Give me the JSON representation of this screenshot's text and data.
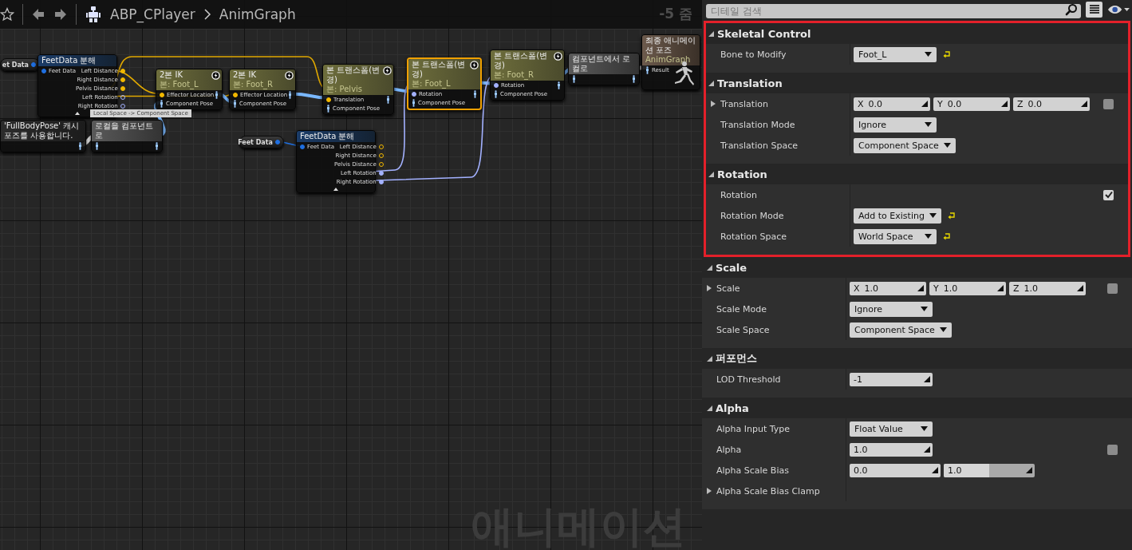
{
  "toolbar": {
    "breadcrumb": [
      "ABP_CPlayer",
      "AnimGraph"
    ],
    "zoom": "-5 줌"
  },
  "graph": {
    "watermark": "애니메이션",
    "tooltip": "Local Space -> Component Space",
    "nodes": [
      {
        "kind": "variable",
        "selected": false,
        "title": "et Data",
        "outputs": [
          {
            "kind": "struct",
            "connected": true
          }
        ]
      },
      {
        "kind": "break",
        "selected": false,
        "title": "FeetData 분해",
        "inputs": [
          {
            "kind": "struct",
            "connected": true,
            "label": "Feet Data"
          }
        ],
        "outputs": [
          {
            "kind": "float",
            "connected": true,
            "label": "Left Distance"
          },
          {
            "kind": "float",
            "connected": true,
            "label": "Right Distance"
          },
          {
            "kind": "float",
            "connected": true,
            "label": "Pelvis Distance"
          },
          {
            "kind": "rotator",
            "connected": false,
            "label": "Left Rotation"
          },
          {
            "kind": "rotator",
            "connected": false,
            "label": "Right Rotation"
          }
        ]
      },
      {
        "kind": "skeletal",
        "selected": false,
        "title": "2본 IK",
        "subtitle": "본: Foot_L",
        "inputs": [
          {
            "kind": "float",
            "connected": true,
            "label": "Effector Location"
          },
          {
            "kind": "pose",
            "connected": true,
            "label": "Component Pose"
          }
        ],
        "outputs": [
          {
            "kind": "pose",
            "connected": true
          }
        ]
      },
      {
        "kind": "skeletal",
        "selected": false,
        "title": "2본 IK",
        "subtitle": "본: Foot_R",
        "inputs": [
          {
            "kind": "float",
            "connected": true,
            "label": "Effector Location"
          },
          {
            "kind": "pose",
            "connected": true,
            "label": "Component Pose"
          }
        ],
        "outputs": [
          {
            "kind": "pose",
            "connected": true
          }
        ]
      },
      {
        "kind": "skeletal",
        "selected": false,
        "title": "본 트랜스폼(변경)",
        "subtitle": "본: Pelvis",
        "inputs": [
          {
            "kind": "float",
            "connected": true,
            "label": "Translation"
          },
          {
            "kind": "pose",
            "connected": true,
            "label": "Component Pose"
          }
        ],
        "outputs": [
          {
            "kind": "pose",
            "connected": true
          }
        ]
      },
      {
        "kind": "skeletal",
        "selected": true,
        "title": "본 트랜스폼(변경)",
        "subtitle": "본: Foot_L",
        "inputs": [
          {
            "kind": "rotator",
            "connected": true,
            "label": "Rotation"
          },
          {
            "kind": "pose",
            "connected": true,
            "label": "Component Pose"
          }
        ],
        "outputs": [
          {
            "kind": "pose",
            "connected": true
          }
        ]
      },
      {
        "kind": "skeletal",
        "selected": false,
        "title": "본 트랜스폼(변경)",
        "subtitle": "본: Foot_R",
        "inputs": [
          {
            "kind": "rotator",
            "connected": true,
            "label": "Rotation"
          },
          {
            "kind": "pose",
            "connected": true,
            "label": "Component Pose"
          }
        ],
        "outputs": [
          {
            "kind": "pose",
            "connected": true
          }
        ]
      },
      {
        "kind": "convert",
        "selected": false,
        "title": "컴포넌트에서 로컬로",
        "inputs": [
          {
            "kind": "pose",
            "connected": true
          }
        ],
        "outputs": [
          {
            "kind": "pose",
            "connected": true
          }
        ]
      },
      {
        "kind": "result",
        "selected": false,
        "title": "최종 애니메이션 포즈",
        "subtitle": "AnimGraph",
        "inputs": [
          {
            "kind": "pose",
            "connected": true,
            "label": "Result"
          }
        ]
      },
      {
        "kind": "cache",
        "selected": false,
        "title": "'FullBodyPose' 캐시 포즈를 사용합니다.",
        "outputs": [
          {
            "kind": "pose",
            "connected": true
          }
        ]
      },
      {
        "kind": "convert",
        "selected": false,
        "title": "로컬을 컴포넌트로",
        "inputs": [
          {
            "kind": "pose",
            "connected": true
          }
        ],
        "outputs": [
          {
            "kind": "pose",
            "connected": true
          }
        ]
      },
      {
        "kind": "variable",
        "selected": false,
        "title": "Feet Data",
        "outputs": [
          {
            "kind": "struct",
            "connected": true
          }
        ]
      },
      {
        "kind": "break",
        "selected": false,
        "title": "FeetData 분해",
        "inputs": [
          {
            "kind": "struct",
            "connected": true,
            "label": "Feet Data"
          }
        ],
        "outputs": [
          {
            "kind": "float",
            "connected": false,
            "label": "Left Distance"
          },
          {
            "kind": "float",
            "connected": false,
            "label": "Right Distance"
          },
          {
            "kind": "float",
            "connected": false,
            "label": "Pelvis Distance"
          },
          {
            "kind": "rotator",
            "connected": true,
            "label": "Left Rotation"
          },
          {
            "kind": "rotator",
            "connected": true,
            "label": "Right Rotation"
          }
        ]
      }
    ]
  },
  "details": {
    "search": {
      "placeholder": "디테일 검색"
    },
    "sections": [
      {
        "title": "Skeletal Control",
        "highlighted": true,
        "expanded": true,
        "rows": [
          {
            "kind": "dropdown",
            "label": "Bone to Modify",
            "value": "Foot_L",
            "reset": true
          }
        ]
      },
      {
        "title": "Translation",
        "highlighted": true,
        "expanded": true,
        "rows": [
          {
            "kind": "vector",
            "label": "Translation",
            "expanded": false,
            "values": [
              {
                "axis": "X",
                "value": "0.0"
              },
              {
                "axis": "Y",
                "value": "0.0"
              },
              {
                "axis": "Z",
                "value": "0.0"
              }
            ],
            "checked": false
          },
          {
            "kind": "dropdown",
            "label": "Translation Mode",
            "value": "Ignore",
            "reset": false
          },
          {
            "kind": "dropdown",
            "label": "Translation Space",
            "value": "Component Space",
            "reset": false
          }
        ]
      },
      {
        "title": "Rotation",
        "highlighted": true,
        "expanded": true,
        "rows": [
          {
            "kind": "checkbox",
            "label": "Rotation",
            "checked": true
          },
          {
            "kind": "dropdown",
            "label": "Rotation Mode",
            "value": "Add to Existing",
            "reset": true
          },
          {
            "kind": "dropdown",
            "label": "Rotation Space",
            "value": "World Space",
            "reset": true
          }
        ]
      },
      {
        "title": "Scale",
        "highlighted": false,
        "expanded": true,
        "rows": [
          {
            "kind": "vector",
            "label": "Scale",
            "expanded": false,
            "values": [
              {
                "axis": "X",
                "value": "1.0"
              },
              {
                "axis": "Y",
                "value": "1.0"
              },
              {
                "axis": "Z",
                "value": "1.0"
              }
            ],
            "checked": false
          },
          {
            "kind": "dropdown",
            "label": "Scale Mode",
            "value": "Ignore",
            "reset": false
          },
          {
            "kind": "dropdown",
            "label": "Scale Space",
            "value": "Component Space",
            "reset": false
          }
        ]
      },
      {
        "title": "퍼포먼스",
        "highlighted": false,
        "expanded": true,
        "rows": [
          {
            "kind": "number",
            "label": "LOD Threshold",
            "value": "-1"
          }
        ]
      },
      {
        "title": "Alpha",
        "highlighted": false,
        "expanded": true,
        "rows": [
          {
            "kind": "dropdown",
            "label": "Alpha Input Type",
            "value": "Float Value",
            "reset": false
          },
          {
            "kind": "number",
            "label": "Alpha",
            "value": "1.0",
            "checked": false
          },
          {
            "kind": "range",
            "label": "Alpha Scale Bias",
            "values": [
              {
                "value": "0.0"
              },
              {
                "value": "1.0",
                "level": 0.5
              }
            ]
          },
          {
            "kind": "group",
            "label": "Alpha Scale Bias Clamp",
            "expanded": false
          }
        ]
      }
    ]
  }
}
